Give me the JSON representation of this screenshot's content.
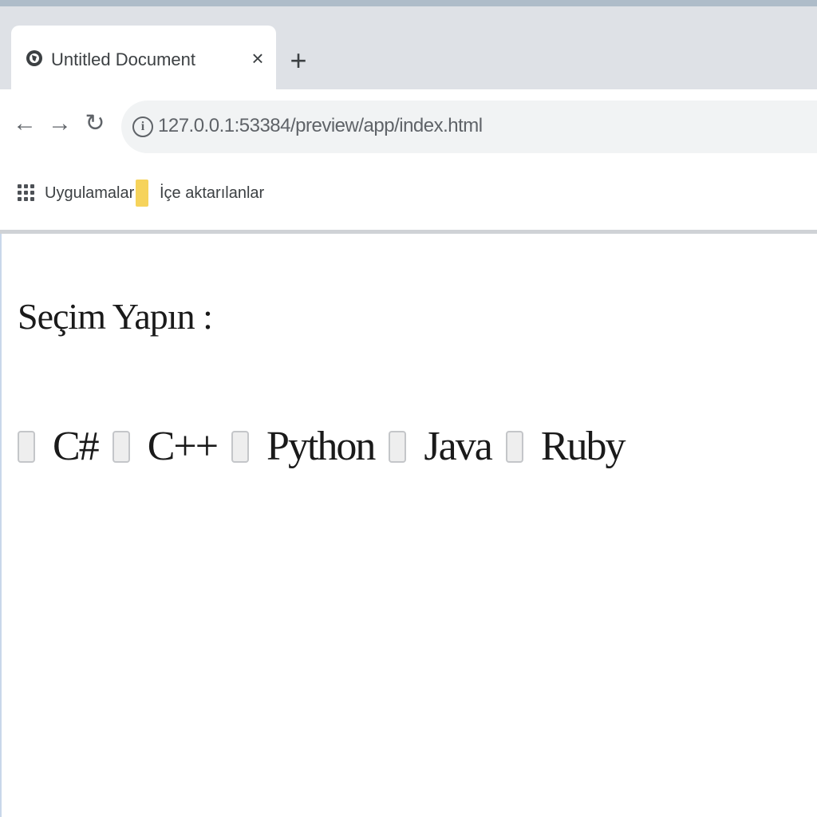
{
  "browser": {
    "tab": {
      "title": "Untitled Document",
      "close_icon": "close-icon",
      "favicon": "globe-icon"
    },
    "new_tab_icon": "plus-icon",
    "nav": {
      "back_icon": "back-arrow-icon",
      "forward_icon": "forward-arrow-icon",
      "reload_icon": "reload-icon"
    },
    "omnibox": {
      "url": "127.0.0.1:53384/preview/app/index.html"
    },
    "bookmarks": [
      {
        "label": "Uygulamalar",
        "icon": "apps-grid-icon"
      },
      {
        "label": "İçe aktarılanlar",
        "icon": "folder-icon"
      }
    ]
  },
  "page": {
    "prompt": "Seçim Yapın :",
    "options": [
      {
        "label": "C#",
        "checked": false
      },
      {
        "label": "C++",
        "checked": false
      },
      {
        "label": "Python",
        "checked": false
      },
      {
        "label": "Java",
        "checked": false
      },
      {
        "label": "Ruby",
        "checked": false
      }
    ]
  },
  "colors": {
    "tabstrip": "#dee1e6",
    "omnibox": "#f1f3f4",
    "folder": "#f6d35b"
  }
}
